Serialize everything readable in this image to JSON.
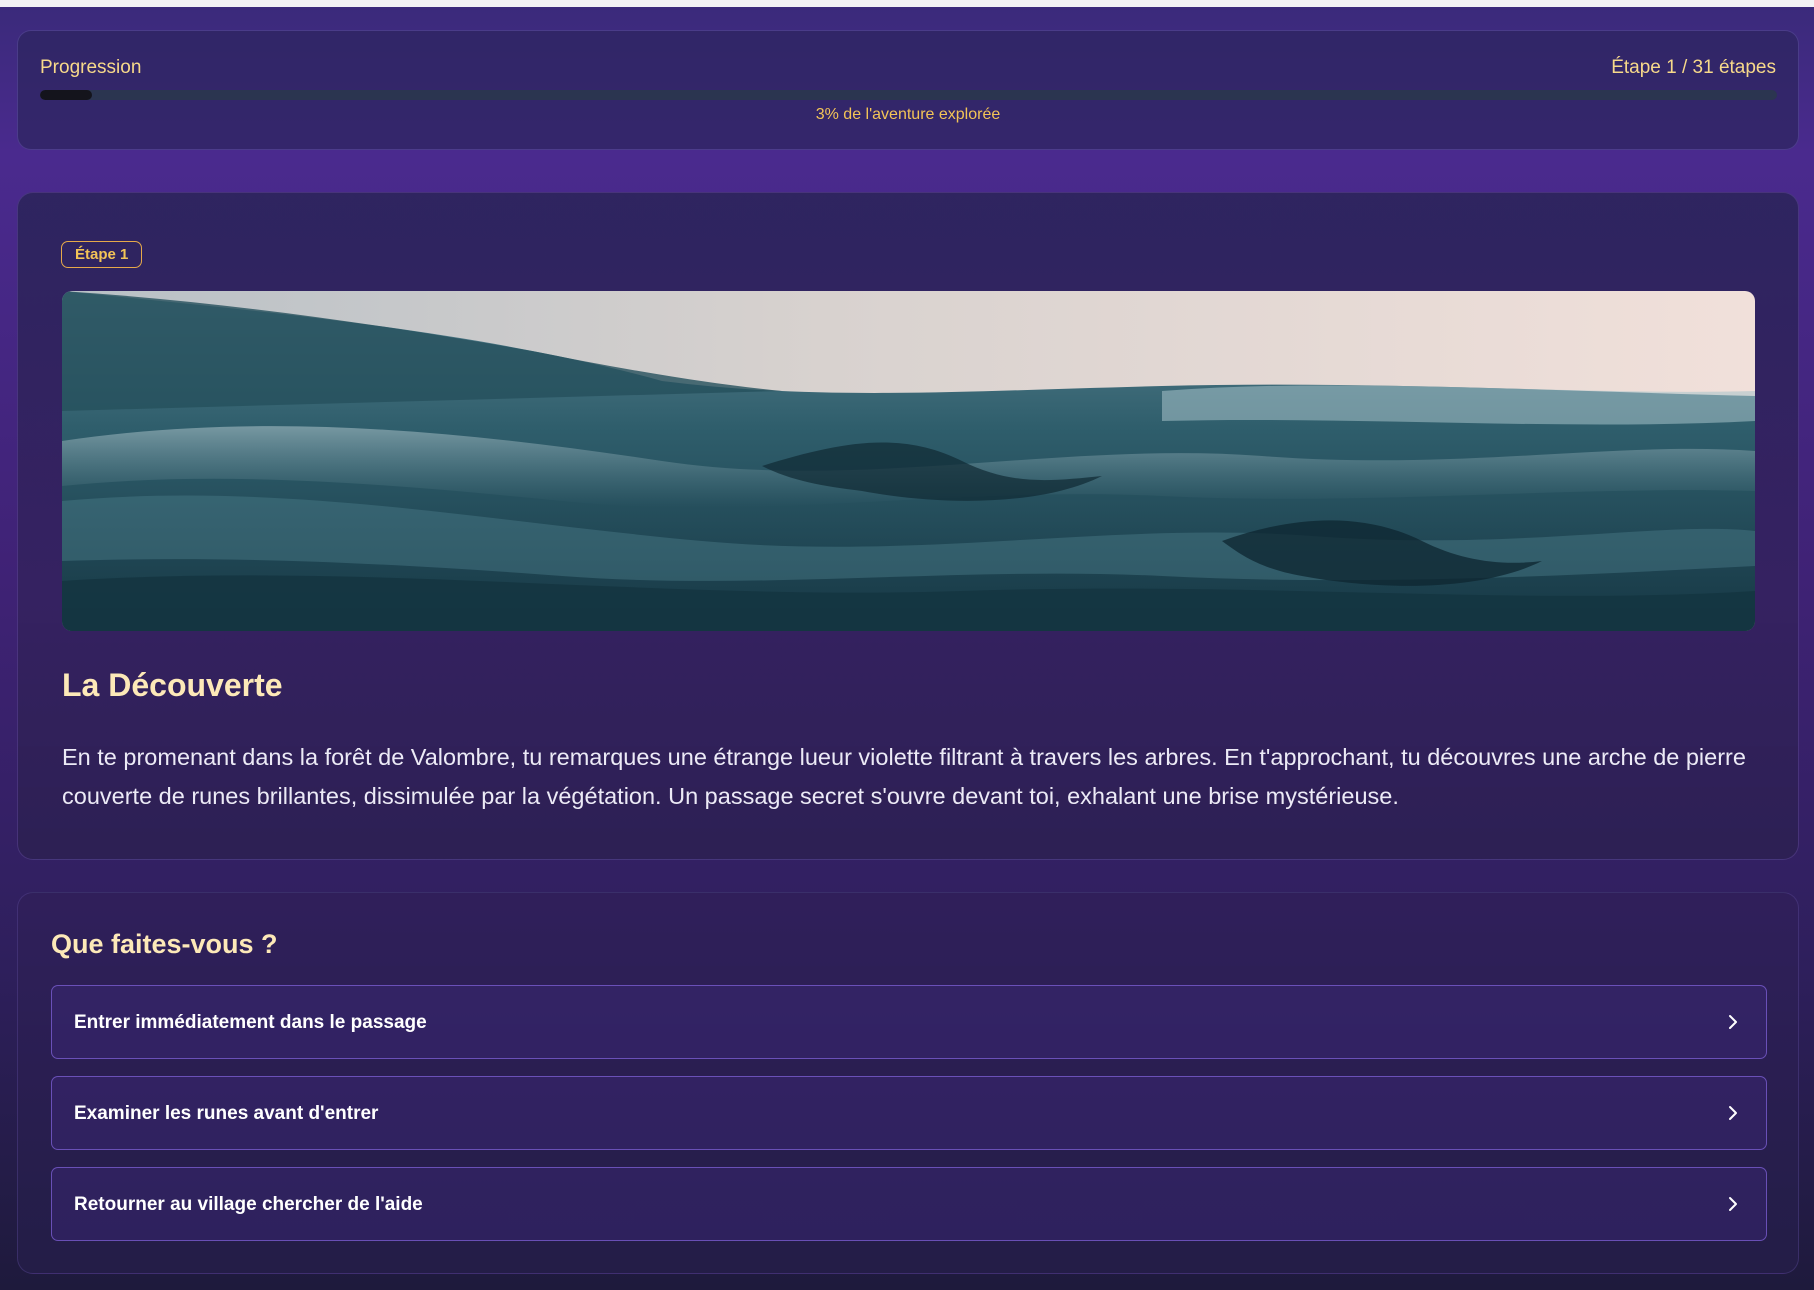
{
  "progress": {
    "label": "Progression",
    "step_text": "Étape 1 / 31 étapes",
    "caption": "3% de l'aventure explorée",
    "percent": 3
  },
  "story": {
    "badge": "Étape 1",
    "image_subject": "ocean-waves",
    "title": "La Découverte",
    "text": "En te promenant dans la forêt de Valombre, tu remarques une étrange lueur violette filtrant à travers les arbres. En t'approchant, tu découvres une arche de pierre couverte de runes brillantes, dissimulée par la végétation. Un passage secret s'ouvre devant toi, exhalant une brise mystérieuse."
  },
  "choices": {
    "title": "Que faites-vous ?",
    "items": [
      {
        "label": "Entrer immédiatement dans le passage",
        "icon": "chevron-right-icon"
      },
      {
        "label": "Examiner les runes avant d'entrer",
        "icon": "chevron-right-icon"
      },
      {
        "label": "Retourner au village chercher de l'aide",
        "icon": "chevron-right-icon"
      }
    ]
  },
  "colors": {
    "accent_gold": "#f3c457",
    "title_cream": "#fde9b8",
    "choice_border": "#8264dc"
  }
}
